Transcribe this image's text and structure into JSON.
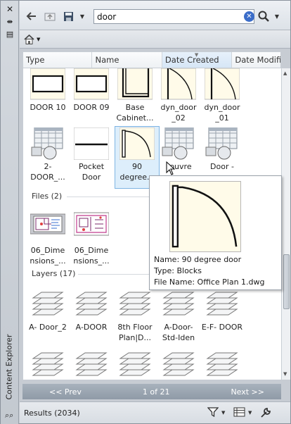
{
  "side": {
    "title": "Content Explorer"
  },
  "search": {
    "value": "door"
  },
  "columns": [
    "Type",
    "Name",
    "Date Created",
    "Date Modifie"
  ],
  "row1": [
    "DOOR 10",
    "DOOR 09",
    "Base Cabinet...",
    "dyn_door _02",
    "dyn_door _01"
  ],
  "row2": [
    "2- DOOR_...",
    "Pocket Door",
    "90 degree...",
    "Louvre",
    "Door -"
  ],
  "files": {
    "header": "Files (2)",
    "items": [
      "06_Dime nsions_...",
      "06_Dime nsions_..."
    ]
  },
  "layers": {
    "header": "Layers (17)",
    "items": [
      "A- Door_2",
      "A-DOOR",
      "8th Floor Plan|D...",
      "A-Door- Std-Iden",
      "E-F- DOOR"
    ]
  },
  "tooltip": {
    "name": "Name: 90 degree door",
    "type": "Type: Blocks",
    "file": "File Name: Office Plan 1.dwg"
  },
  "pager": {
    "prev": "<< Prev",
    "page": "1 of 21",
    "next": "Next >>"
  },
  "status": {
    "results": "Results (2034)"
  },
  "colors": {
    "accent": "#3b6dc9",
    "selection": "#ddeefb",
    "thumb_fill": "#fffbe9"
  }
}
